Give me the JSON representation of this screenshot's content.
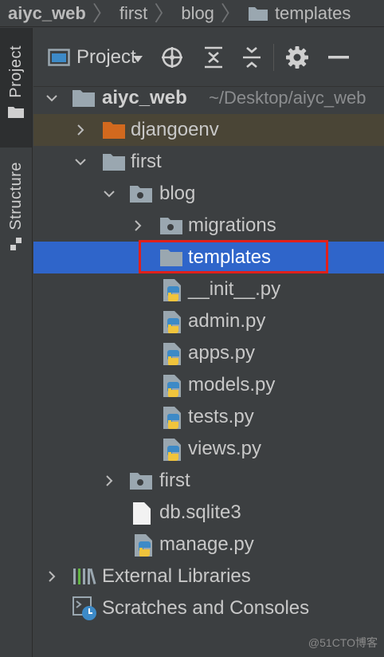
{
  "breadcrumb": {
    "items": [
      "aiyc_web",
      "first",
      "blog",
      "templates"
    ]
  },
  "tool_strip": {
    "project_tab": "Project",
    "structure_tab": "Structure"
  },
  "panel": {
    "view_label": "Project",
    "icons": [
      "project-view-icon",
      "dropdown-icon",
      "locate-icon",
      "expand-all-icon",
      "collapse-all-icon",
      "gear-icon",
      "minimize-icon"
    ]
  },
  "tree": {
    "root_label": "aiyc_web",
    "root_path": "~/Desktop/aiyc_web",
    "items": [
      {
        "label": "djangoenv"
      },
      {
        "label": "first"
      },
      {
        "label": "blog"
      },
      {
        "label": "migrations"
      },
      {
        "label": "templates"
      },
      {
        "label": "__init__.py"
      },
      {
        "label": "admin.py"
      },
      {
        "label": "apps.py"
      },
      {
        "label": "models.py"
      },
      {
        "label": "tests.py"
      },
      {
        "label": "views.py"
      },
      {
        "label": "first"
      },
      {
        "label": "db.sqlite3"
      },
      {
        "label": "manage.py"
      },
      {
        "label": "External Libraries"
      },
      {
        "label": "Scratches and Consoles"
      }
    ]
  },
  "colors": {
    "background": "#3c3f41",
    "selection": "#2f65ca",
    "highlight_box": "#e0201b",
    "excluded_folder": "#d2691e"
  },
  "watermark": "@51CTO博客"
}
